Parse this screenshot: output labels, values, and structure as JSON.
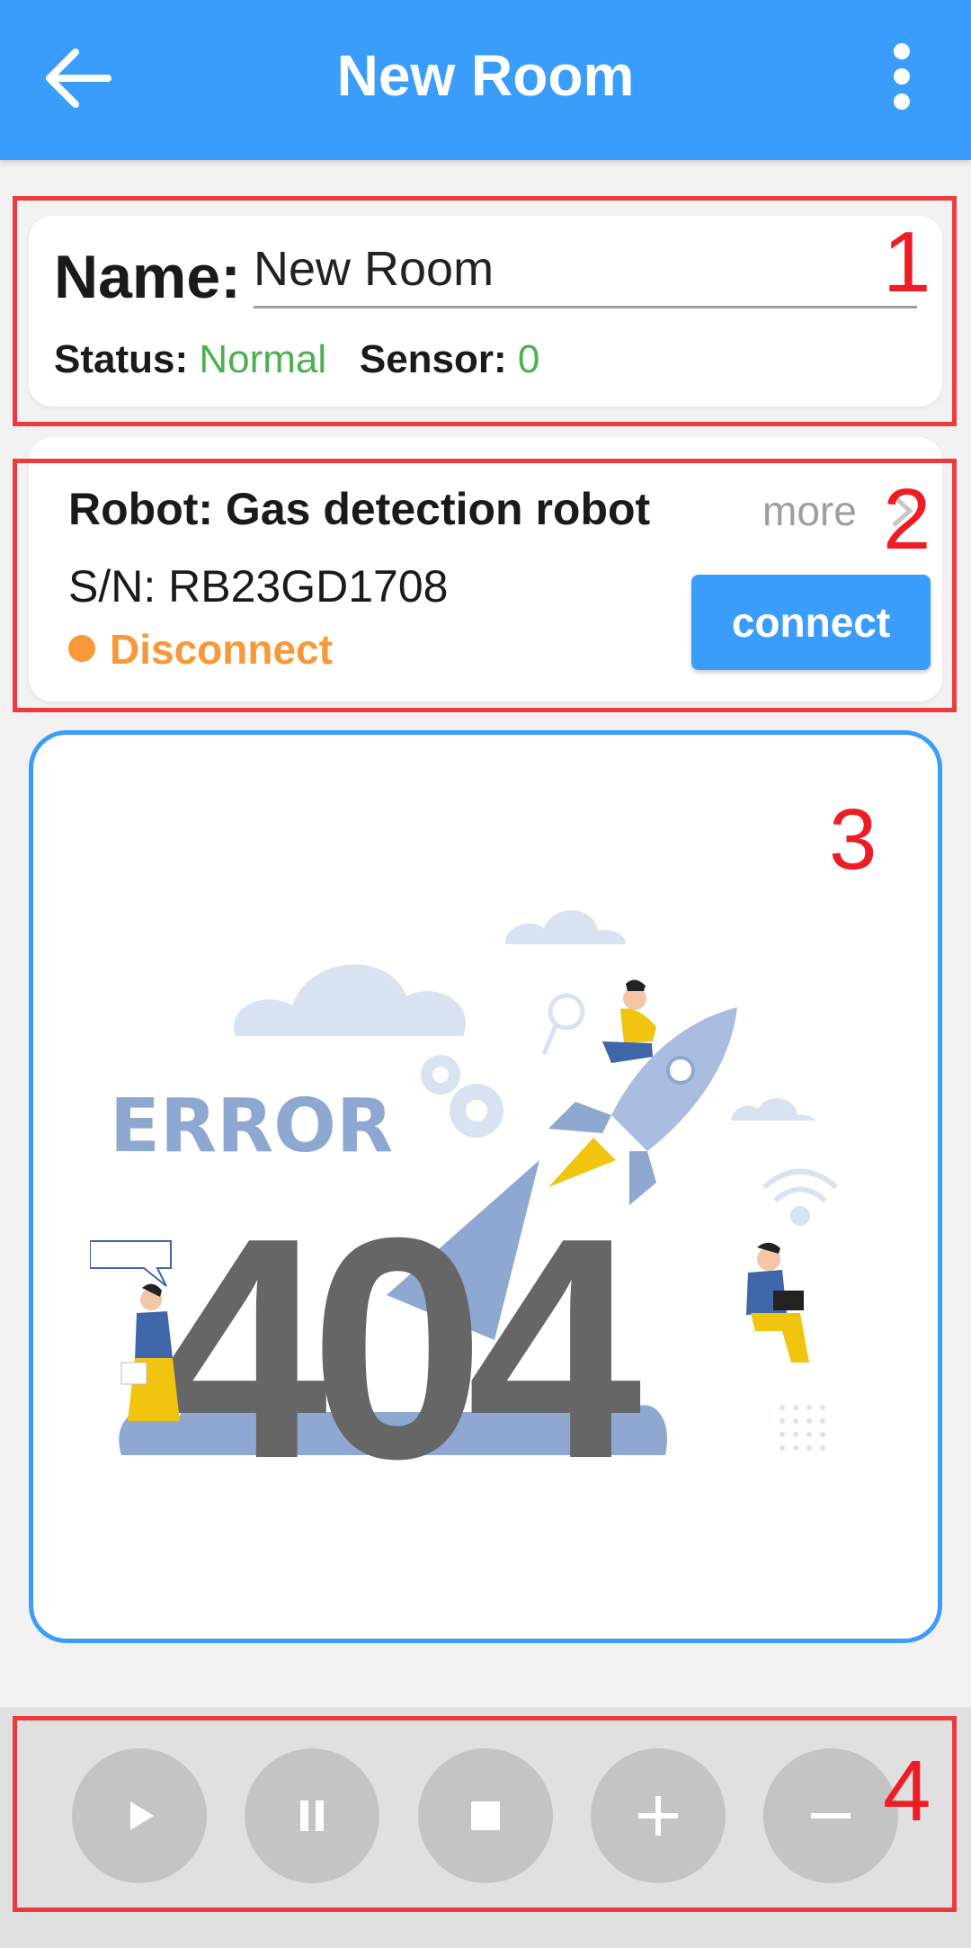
{
  "app_bar": {
    "title": "New Room",
    "back_icon": "arrow-left-icon",
    "menu_icon": "more-vertical-icon",
    "color": "#3b9dfb"
  },
  "room_card": {
    "name_label": "Name:",
    "name_value": "New Room",
    "status_label": "Status:",
    "status_value": "Normal",
    "sensor_label": "Sensor:",
    "sensor_value": "0",
    "value_color": "#4caf50"
  },
  "robot_card": {
    "title": "Robot: Gas detection robot",
    "more_label": "more",
    "more_icon": "chevron-right-icon",
    "serial": "S/N: RB23GD1708",
    "state": "Disconnect",
    "state_color": "#f7993a",
    "connect_label": "connect"
  },
  "video_panel": {
    "error_heading": "ERROR",
    "error_code": "404"
  },
  "controls": {
    "items": [
      {
        "icon": "play-icon"
      },
      {
        "icon": "pause-icon"
      },
      {
        "icon": "stop-icon"
      },
      {
        "icon": "plus-icon"
      },
      {
        "icon": "minus-icon"
      }
    ]
  },
  "annotations": [
    "1",
    "2",
    "3",
    "4"
  ]
}
